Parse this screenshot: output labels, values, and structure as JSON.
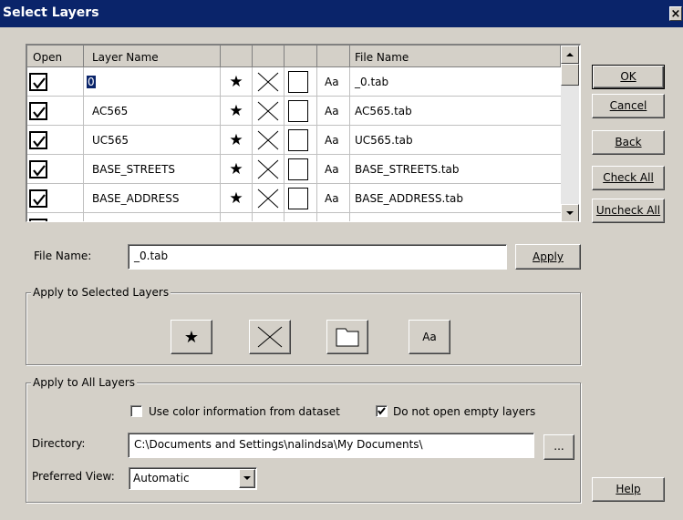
{
  "window": {
    "title": "Select Layers",
    "close_glyph": "×"
  },
  "grid": {
    "columns": {
      "open": "Open",
      "layer_name": "Layer Name",
      "c3": "",
      "c4": "",
      "c5": "",
      "c6": "",
      "file_name": "File Name"
    },
    "rows": [
      {
        "checked": true,
        "layer_name": "0",
        "star": "★",
        "aa": "Aa",
        "file_name": "_0.tab",
        "selected": true
      },
      {
        "checked": true,
        "layer_name": "AC565",
        "star": "★",
        "aa": "Aa",
        "file_name": "AC565.tab"
      },
      {
        "checked": true,
        "layer_name": "UC565",
        "star": "★",
        "aa": "Aa",
        "file_name": "UC565.tab"
      },
      {
        "checked": true,
        "layer_name": "BASE_STREETS",
        "star": "★",
        "aa": "Aa",
        "file_name": "BASE_STREETS.tab"
      },
      {
        "checked": true,
        "layer_name": "BASE_ADDRESS",
        "star": "★",
        "aa": "Aa",
        "file_name": "BASE_ADDRESS.tab"
      }
    ]
  },
  "buttons": {
    "ok": "OK",
    "cancel": "Cancel",
    "back": "Back",
    "check_all": "Check All",
    "uncheck_all": "Uncheck All",
    "apply": "Apply",
    "help": "Help",
    "browse": "..."
  },
  "file_name": {
    "label": "File Name:",
    "value": "_0.tab"
  },
  "apply_selected": {
    "title": "Apply to Selected Layers",
    "aa_label": "Aa",
    "star_glyph": "★"
  },
  "apply_all": {
    "title": "Apply to All Layers",
    "use_color_label": "Use color information from dataset",
    "use_color_checked": false,
    "no_empty_label": "Do not open empty layers",
    "no_empty_checked": true,
    "directory_label": "Directory:",
    "directory_value": "C:\\Documents and Settings\\nalindsa\\My Documents\\",
    "preferred_view_label": "Preferred View:",
    "preferred_view_value": "Automatic"
  },
  "icons": [
    "check-icon",
    "star-icon",
    "cross-icon",
    "square-icon",
    "font-aa-icon",
    "scroll-up-icon",
    "scroll-down-icon",
    "dropdown-arrow-icon"
  ]
}
